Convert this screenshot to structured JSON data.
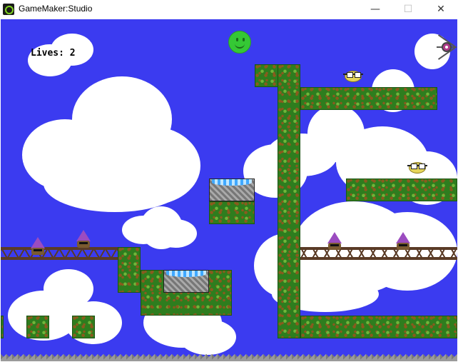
{
  "window": {
    "title": "GameMaker:Studio",
    "minimize_label": "—",
    "maximize_label": "☐",
    "close_label": "✕"
  },
  "hud": {
    "lives_label": "Lives: 2"
  },
  "colors": {
    "sky": "#3b3bf0",
    "grass": "#2e7d1e",
    "player": "#35c835",
    "gnome_hat": "#9b4cc0",
    "enemy_bird": "#e5d55a"
  },
  "icons": {
    "app": "gamemaker-icon",
    "player": "smiley-face",
    "enemies": [
      "bird-with-glasses",
      "gnome",
      "spider"
    ]
  }
}
